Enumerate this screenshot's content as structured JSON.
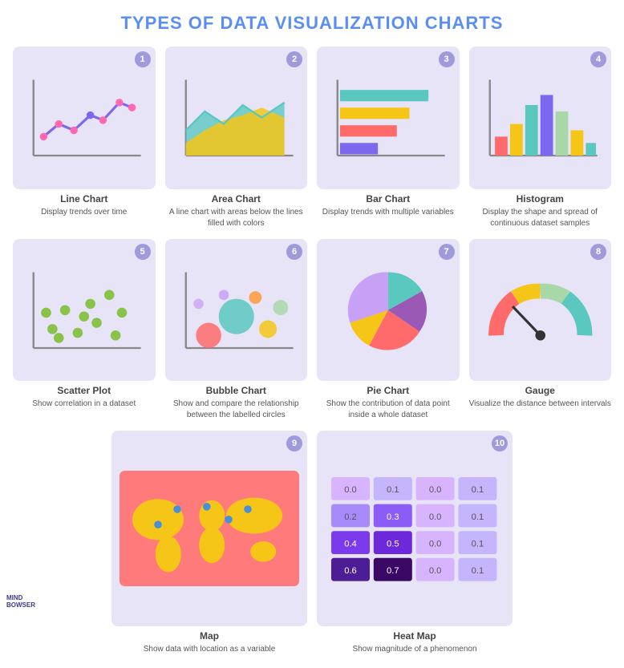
{
  "title": {
    "part1": "Types of Data Visualization ",
    "part2": "Charts"
  },
  "cards": [
    {
      "id": 1,
      "label": "Line Chart",
      "desc": "Display trends over time"
    },
    {
      "id": 2,
      "label": "Area Chart",
      "desc": "A line chart with areas below the lines filled with colors"
    },
    {
      "id": 3,
      "label": "Bar Chart",
      "desc": "Display trends with multiple variables"
    },
    {
      "id": 4,
      "label": "Histogram",
      "desc": "Display the shape and spread of continuous dataset samples"
    },
    {
      "id": 5,
      "label": "Scatter Plot",
      "desc": "Show correlation in a dataset"
    },
    {
      "id": 6,
      "label": "Bubble Chart",
      "desc": "Show and compare the relationship between the labelled circles"
    },
    {
      "id": 7,
      "label": "Pie Chart",
      "desc": "Show the contribution of data point inside a whole dataset"
    },
    {
      "id": 8,
      "label": "Gauge",
      "desc": "Visualize the distance between intervals"
    },
    {
      "id": 9,
      "label": "Map",
      "desc": "Show data with location as a variable"
    },
    {
      "id": 10,
      "label": "Heat Map",
      "desc": "Show magnitude of a phenomenon"
    }
  ]
}
